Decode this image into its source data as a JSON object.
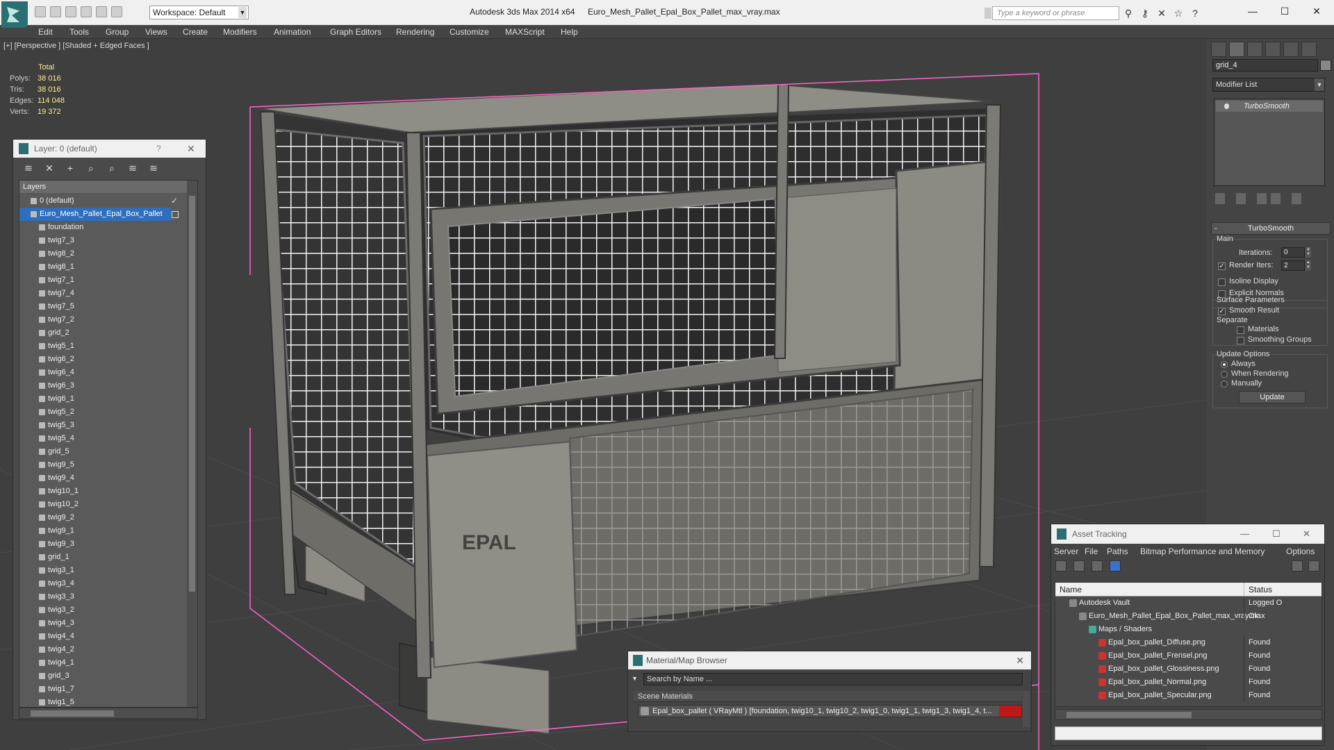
{
  "titlebar": {
    "workspace": "Workspace: Default",
    "app_title": "Autodesk 3ds Max  2014 x64",
    "file_title": "Euro_Mesh_Pallet_Epal_Box_Pallet_max_vray.max",
    "search_placeholder": "Type a keyword or phrase"
  },
  "menu": [
    "Edit",
    "Tools",
    "Group",
    "Views",
    "Create",
    "Modifiers",
    "Animation",
    "Graph Editors",
    "Rendering",
    "Customize",
    "MAXScript",
    "Help"
  ],
  "viewport": {
    "label": "[+] [Perspective ] [Shaded + Edged Faces ]",
    "stats": {
      "header": "Total",
      "polys_label": "Polys:",
      "polys": "38 016",
      "tris_label": "Tris:",
      "tris": "38 016",
      "edges_label": "Edges:",
      "edges": "114 048",
      "verts_label": "Verts:",
      "verts": "19 372"
    }
  },
  "layer_panel": {
    "title": "Layer: 0 (default)",
    "help": "?",
    "header": "Layers",
    "rows": [
      {
        "label": "0 (default)",
        "level": 0,
        "checked": true
      },
      {
        "label": "Euro_Mesh_Pallet_Epal_Box_Pallet",
        "level": 0,
        "selected": true
      },
      {
        "label": "foundation",
        "level": 1
      },
      {
        "label": "twig7_3",
        "level": 1
      },
      {
        "label": "twig8_2",
        "level": 1
      },
      {
        "label": "twig8_1",
        "level": 1
      },
      {
        "label": "twig7_1",
        "level": 1
      },
      {
        "label": "twig7_4",
        "level": 1
      },
      {
        "label": "twig7_5",
        "level": 1
      },
      {
        "label": "twig7_2",
        "level": 1
      },
      {
        "label": "grid_2",
        "level": 1
      },
      {
        "label": "twig5_1",
        "level": 1
      },
      {
        "label": "twig6_2",
        "level": 1
      },
      {
        "label": "twig6_4",
        "level": 1
      },
      {
        "label": "twig6_3",
        "level": 1
      },
      {
        "label": "twig6_1",
        "level": 1
      },
      {
        "label": "twig5_2",
        "level": 1
      },
      {
        "label": "twig5_3",
        "level": 1
      },
      {
        "label": "twig5_4",
        "level": 1
      },
      {
        "label": "grid_5",
        "level": 1
      },
      {
        "label": "twig9_5",
        "level": 1
      },
      {
        "label": "twig9_4",
        "level": 1
      },
      {
        "label": "twig10_1",
        "level": 1
      },
      {
        "label": "twig10_2",
        "level": 1
      },
      {
        "label": "twig9_2",
        "level": 1
      },
      {
        "label": "twig9_1",
        "level": 1
      },
      {
        "label": "twig9_3",
        "level": 1
      },
      {
        "label": "grid_1",
        "level": 1
      },
      {
        "label": "twig3_1",
        "level": 1
      },
      {
        "label": "twig3_4",
        "level": 1
      },
      {
        "label": "twig3_3",
        "level": 1
      },
      {
        "label": "twig3_2",
        "level": 1
      },
      {
        "label": "twig4_3",
        "level": 1
      },
      {
        "label": "twig4_4",
        "level": 1
      },
      {
        "label": "twig4_2",
        "level": 1
      },
      {
        "label": "twig4_1",
        "level": 1
      },
      {
        "label": "grid_3",
        "level": 1
      },
      {
        "label": "twig1_7",
        "level": 1
      },
      {
        "label": "twig1_5",
        "level": 1
      }
    ]
  },
  "command_panel": {
    "object_name": "grid_4",
    "modifier_list": "Modifier List",
    "stack_item": "TurboSmooth",
    "turbosmooth": {
      "title": "TurboSmooth",
      "main": "Main",
      "iterations_label": "Iterations:",
      "iterations": "0",
      "render_iters_label": "Render Iters:",
      "render_iters": "2",
      "isoline": "Isoline Display",
      "explicit_normals": "Explicit Normals",
      "surface_params": "Surface Parameters",
      "smooth_result": "Smooth Result",
      "separate": "Separate",
      "materials": "Materials",
      "smoothing_groups": "Smoothing Groups",
      "update_options": "Update Options",
      "always": "Always",
      "when_rendering": "When Rendering",
      "manually": "Manually",
      "update_btn": "Update"
    }
  },
  "material_browser": {
    "title": "Material/Map Browser",
    "search": "Search by Name ...",
    "section": "Scene Materials",
    "entry": "Epal_box_pallet  ( VRayMtl )  [foundation, twig10_1, twig10_2, twig1_0, twig1_1, twig1_3, twig1_4, t..."
  },
  "asset_tracking": {
    "title": "Asset Tracking",
    "menu": [
      "Server",
      "File",
      "Paths",
      "Bitmap Performance and Memory",
      "Options"
    ],
    "col_name": "Name",
    "col_status": "Status",
    "rows": [
      {
        "name": "Autodesk Vault",
        "status": "Logged O",
        "indent": 1
      },
      {
        "name": "Euro_Mesh_Pallet_Epal_Box_Pallet_max_vray.max",
        "status": "Ok",
        "indent": 2
      },
      {
        "name": "Maps / Shaders",
        "status": "",
        "indent": 3
      },
      {
        "name": "Epal_box_pallet_Diffuse.png",
        "status": "Found",
        "indent": 4
      },
      {
        "name": "Epal_box_pallet_Frensel.png",
        "status": "Found",
        "indent": 4
      },
      {
        "name": "Epal_box_pallet_Glossiness.png",
        "status": "Found",
        "indent": 4
      },
      {
        "name": "Epal_box_pallet_Normal.png",
        "status": "Found",
        "indent": 4
      },
      {
        "name": "Epal_box_pallet_Specular.png",
        "status": "Found",
        "indent": 4
      }
    ]
  },
  "colors": {
    "selection": "#2e6ebd",
    "stat_value": "#ffee88",
    "bbox": "#ff66cc",
    "floor": "#e7d5ad"
  }
}
